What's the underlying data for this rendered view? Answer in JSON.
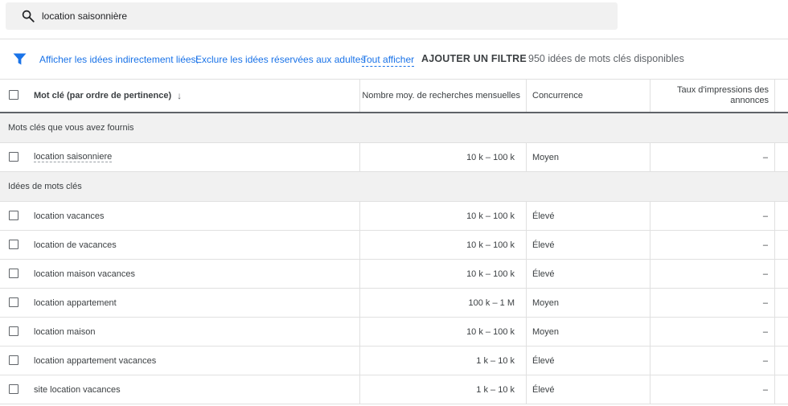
{
  "search": {
    "query": "location saisonnière",
    "icon": "search-icon"
  },
  "filters": {
    "link1": "Afficher les idées indirectement liées;",
    "link2": "Exclure les idées réservées aux adultes",
    "show_all": "Tout afficher",
    "add_filter": "AJOUTER UN FILTRE",
    "count": "950 idées de mots clés disponibles",
    "accent": "#1a73e8"
  },
  "table": {
    "headers": {
      "keyword": "Mot clé (par ordre de pertinence)",
      "sort_arrow": "↓",
      "volume": "Nombre moy. de recherches mensuelles",
      "competition": "Concurrence",
      "impressions_line1": "Taux d'impressions des",
      "impressions_line2": "annonces"
    },
    "section1": {
      "title": "Mots clés que vous avez fournis",
      "rows": [
        {
          "keyword": "location saisonniere",
          "volume": "10 k – 100 k",
          "competition": "Moyen",
          "impressions": "–"
        }
      ]
    },
    "section2": {
      "title": "Idées de mots clés",
      "rows": [
        {
          "keyword": "location vacances",
          "volume": "10 k – 100 k",
          "competition": "Élevé",
          "impressions": "–"
        },
        {
          "keyword": "location de vacances",
          "volume": "10 k – 100 k",
          "competition": "Élevé",
          "impressions": "–"
        },
        {
          "keyword": "location maison vacances",
          "volume": "10 k – 100 k",
          "competition": "Élevé",
          "impressions": "–"
        },
        {
          "keyword": "location appartement",
          "volume": "100 k – 1 M",
          "competition": "Moyen",
          "impressions": "–"
        },
        {
          "keyword": "location maison",
          "volume": "10 k – 100 k",
          "competition": "Moyen",
          "impressions": "–"
        },
        {
          "keyword": "location appartement vacances",
          "volume": "1 k – 10 k",
          "competition": "Élevé",
          "impressions": "–"
        },
        {
          "keyword": "site location vacances",
          "volume": "1 k – 10 k",
          "competition": "Élevé",
          "impressions": "–"
        }
      ]
    }
  }
}
